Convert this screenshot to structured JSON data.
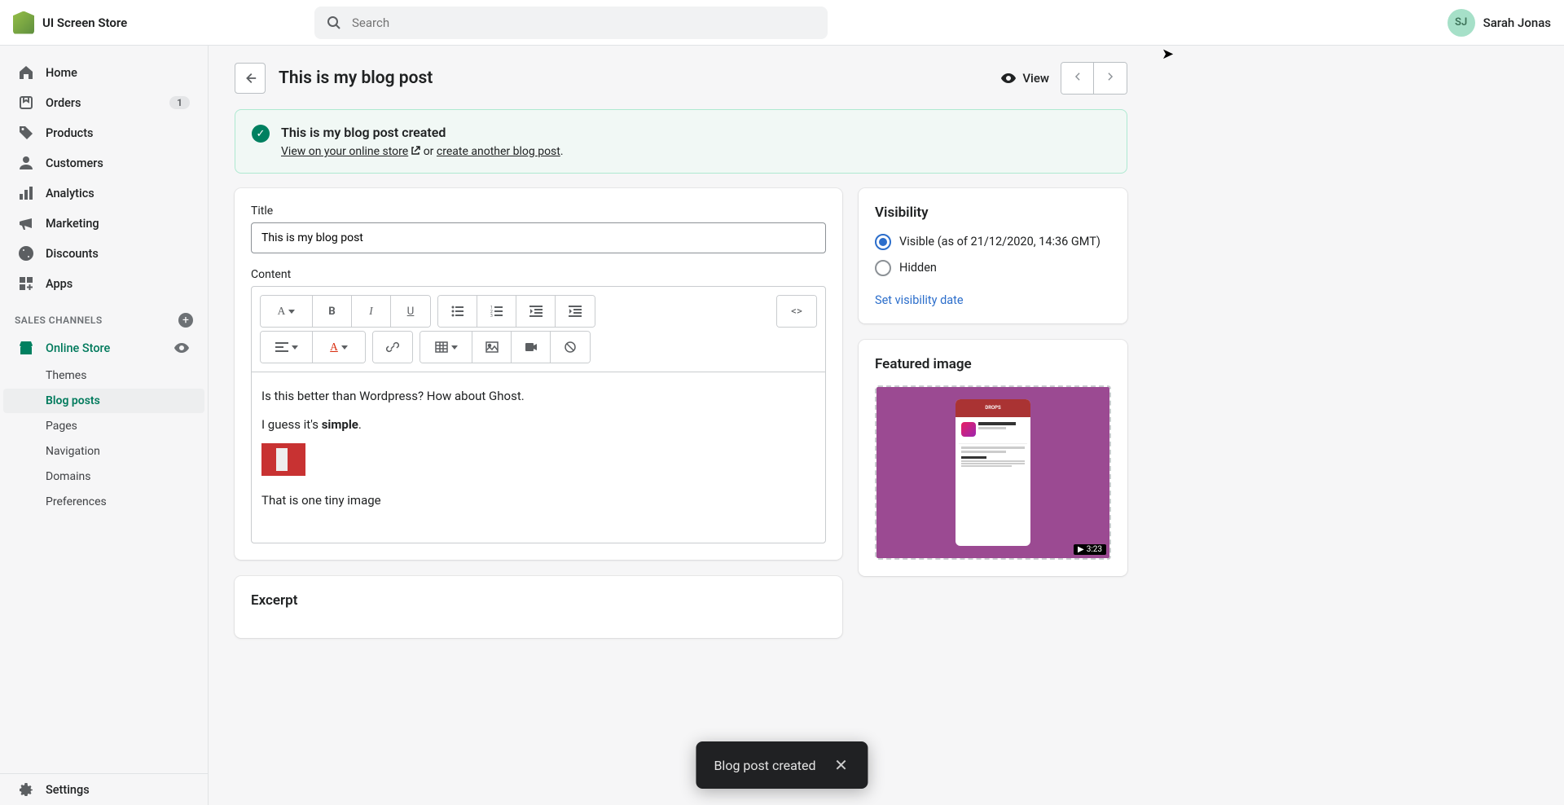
{
  "header": {
    "store_name": "UI Screen Store",
    "search_placeholder": "Search",
    "user_initials": "SJ",
    "user_name": "Sarah Jonas"
  },
  "sidebar": {
    "items": [
      {
        "label": "Home",
        "icon": "home"
      },
      {
        "label": "Orders",
        "icon": "orders",
        "badge": "1"
      },
      {
        "label": "Products",
        "icon": "products"
      },
      {
        "label": "Customers",
        "icon": "customers"
      },
      {
        "label": "Analytics",
        "icon": "analytics"
      },
      {
        "label": "Marketing",
        "icon": "marketing"
      },
      {
        "label": "Discounts",
        "icon": "discounts"
      },
      {
        "label": "Apps",
        "icon": "apps"
      }
    ],
    "section_label": "SALES CHANNELS",
    "online_store": "Online Store",
    "sub_items": [
      {
        "label": "Themes"
      },
      {
        "label": "Blog posts",
        "selected": true
      },
      {
        "label": "Pages"
      },
      {
        "label": "Navigation"
      },
      {
        "label": "Domains"
      },
      {
        "label": "Preferences"
      }
    ],
    "settings_label": "Settings"
  },
  "page": {
    "title": "This is my blog post",
    "view_label": "View",
    "banner": {
      "title": "This is my blog post created",
      "view_link": "View on your online store",
      "or_text": " or ",
      "create_link": "create another blog post",
      "period": "."
    },
    "form": {
      "title_label": "Title",
      "title_value": "This is my blog post",
      "content_label": "Content",
      "content_line1": "Is this better than Wordpress? How about Ghost.",
      "content_line2_prefix": "I guess it's ",
      "content_line2_bold": "simple",
      "content_line2_suffix": ".",
      "content_line3": "That is one tiny image",
      "excerpt_label": "Excerpt"
    },
    "visibility": {
      "heading": "Visibility",
      "visible_label": "Visible (as of 21/12/2020, 14:36 GMT)",
      "hidden_label": "Hidden",
      "set_date_link": "Set visibility date"
    },
    "featured": {
      "heading": "Featured image",
      "phone_brand": "DROPS",
      "video_time": "3:23"
    }
  },
  "toast": {
    "message": "Blog post created"
  }
}
